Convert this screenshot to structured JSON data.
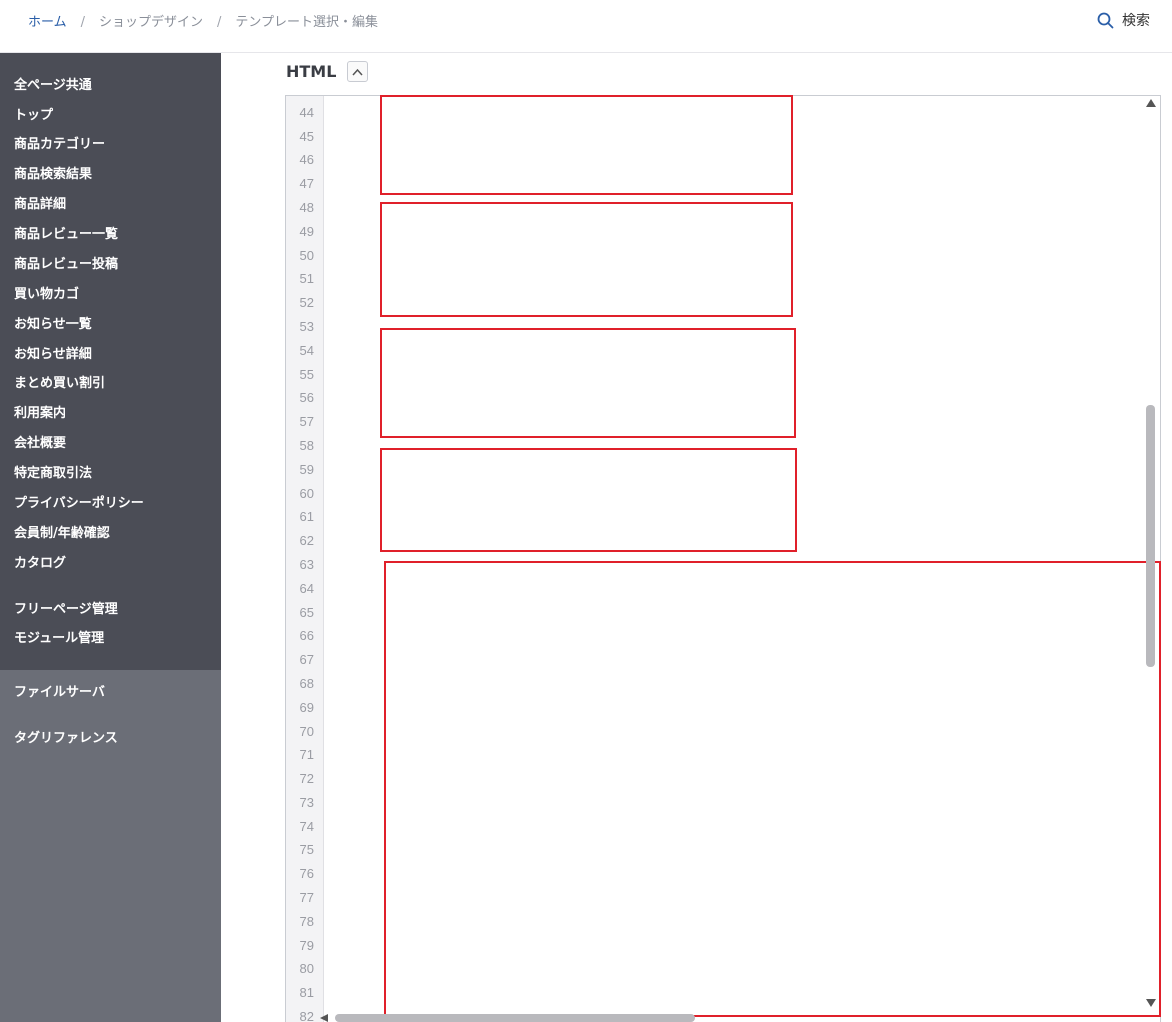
{
  "breadcrumb": {
    "home": "ホーム",
    "sep1": "/",
    "shop_design": "ショップデザイン",
    "sep2": "/",
    "template": "テンプレート選択・編集"
  },
  "search": {
    "label": "検索",
    "icon": "search-icon"
  },
  "sidebar": {
    "items": [
      "全ページ共通",
      "トップ",
      "商品カテゴリー",
      "商品検索結果",
      "商品詳細",
      "商品レビュー一覧",
      "商品レビュー投稿",
      "買い物カゴ",
      "お知らせ一覧",
      "お知らせ詳細",
      "まとめ買い割引",
      "利用案内",
      "会社概要",
      "特定商取引法",
      "プライバシーポリシー",
      "会員制/年齢確認",
      "カタログ"
    ],
    "manage": [
      "フリーページ管理",
      "モジュール管理"
    ],
    "lower": [
      "ファイルサーバ",
      "タグリファレンス"
    ],
    "colors": {
      "upper": "#4b4d56",
      "lower": "#6b6e77"
    }
  },
  "editor": {
    "title": "HTML",
    "collapse_icon": "chevron-up-icon",
    "line_numbers": [
      "44",
      "45",
      "46",
      "47",
      "48",
      "49",
      "50",
      "51",
      "52",
      "53",
      "54",
      "55",
      "56",
      "57",
      "58",
      "59",
      "60",
      "61",
      "62",
      "63",
      "64",
      "65",
      "66",
      "67",
      "68",
      "69",
      "70",
      "71",
      "72",
      "73",
      "74",
      "75",
      "76",
      "77",
      "78",
      "79",
      "80",
      "81",
      "82"
    ],
    "highlight_color": "#e0202a"
  }
}
